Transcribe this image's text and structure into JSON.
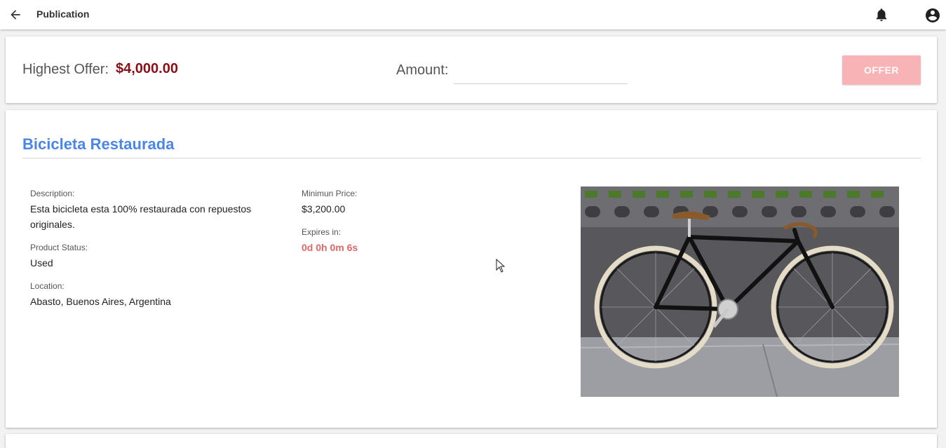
{
  "header": {
    "title": "Publication",
    "icons": {
      "back": "arrow-back-icon",
      "notifications": "bell-icon",
      "account": "account-circle-icon"
    }
  },
  "offer_bar": {
    "highest_offer_label": "Highest Offer:",
    "highest_offer_value": "$4,000.00",
    "amount_label": "Amount:",
    "amount_value": "",
    "offer_button_label": "OFFER"
  },
  "product": {
    "title": "Bicicleta Restaurada",
    "description_label": "Description:",
    "description_value": "Esta bicicleta esta 100% restaurada con repuestos originales.",
    "status_label": "Product Status:",
    "status_value": "Used",
    "location_label": "Location:",
    "location_value": "Abasto, Buenos Aires, Argentina",
    "min_price_label": "Minimun Price:",
    "min_price_value": "$3,200.00",
    "expires_label": "Expires in:",
    "expires_value": "0d 0h 0m 6s",
    "image": "bicycle-photo"
  },
  "colors": {
    "title_blue": "#4a86e8",
    "offer_value_red": "#8b0f16",
    "expires_red": "#e06666",
    "offer_button_pink": "#f7b3b5"
  }
}
